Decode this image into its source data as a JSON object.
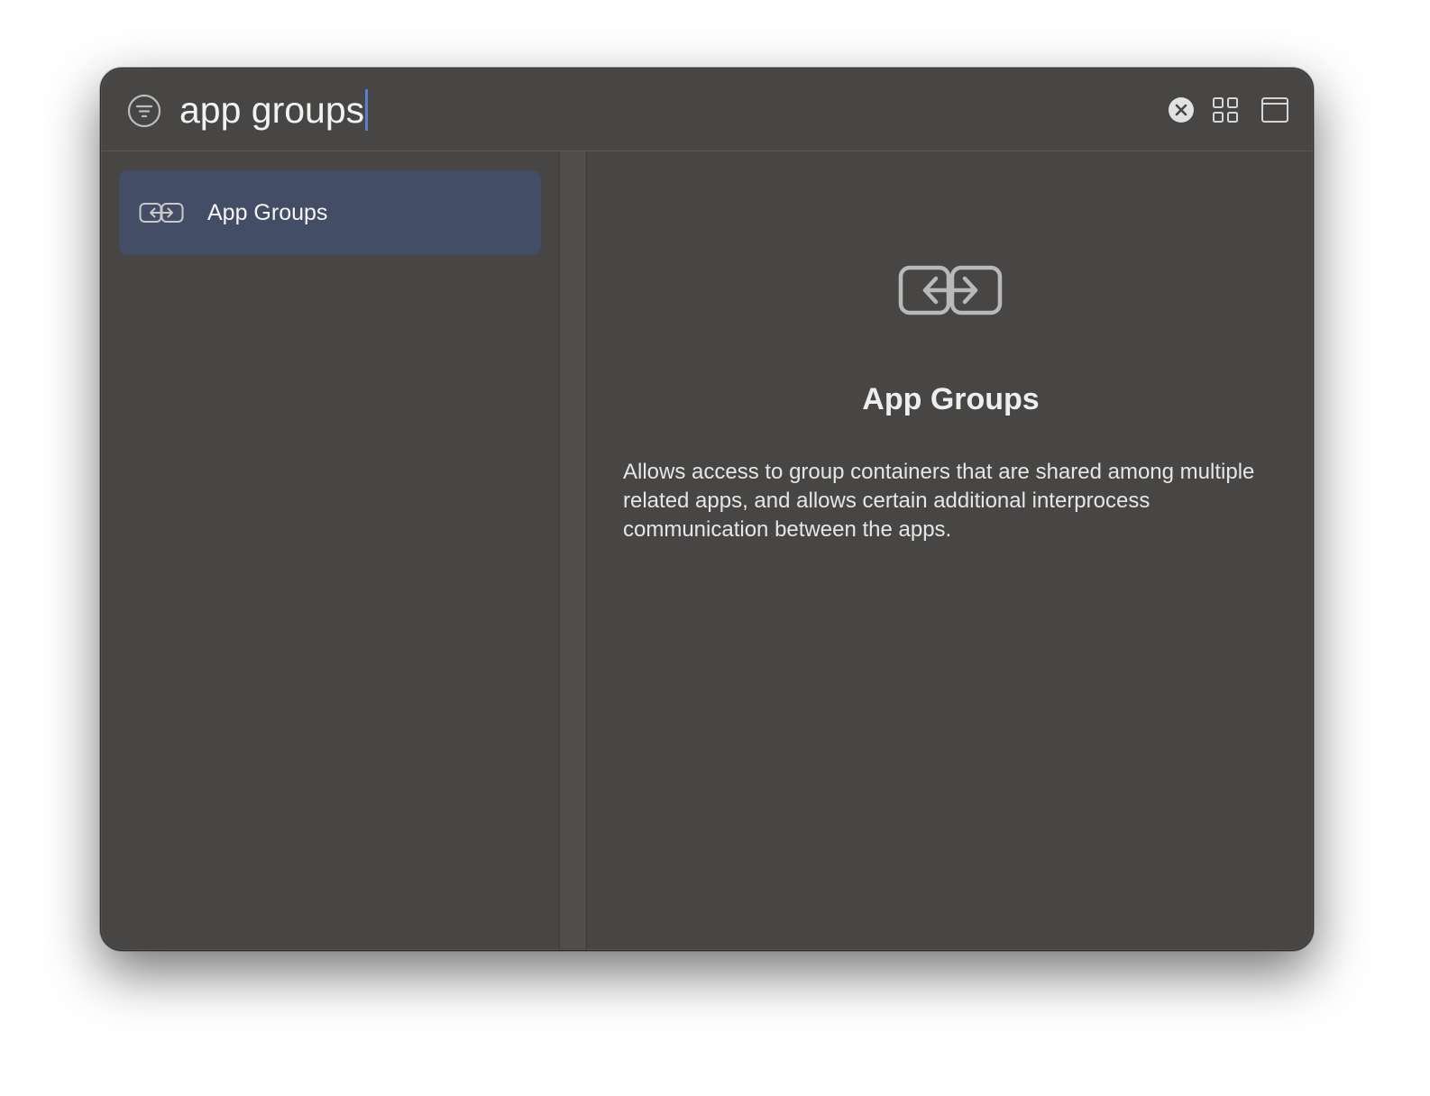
{
  "search": {
    "query": "app groups"
  },
  "toolbar": {
    "filter_icon": "filter-icon",
    "clear_icon": "clear-search-icon",
    "grid_icon": "grid-view-icon",
    "panel_icon": "window-panel-icon"
  },
  "results": {
    "items": [
      {
        "label": "App Groups",
        "icon": "link-arrows-icon",
        "selected": true
      }
    ]
  },
  "detail": {
    "icon": "link-arrows-icon",
    "title": "App Groups",
    "description": "Allows access to group containers that are shared among multiple related apps, and allows certain additional interprocess communication between the apps."
  },
  "colors": {
    "window_bg": "#474645",
    "selection_bg": "#434e66",
    "caret": "#5b7fcf",
    "text": "#f2f2f2"
  }
}
